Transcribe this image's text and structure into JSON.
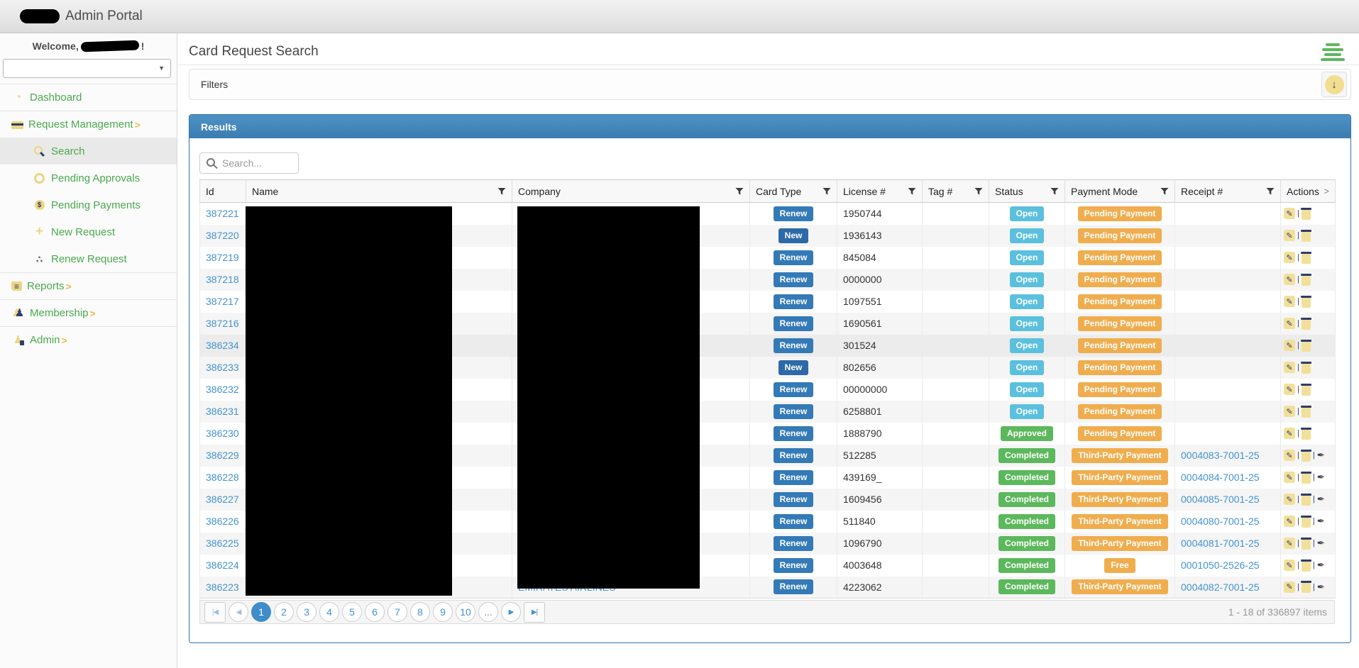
{
  "header": {
    "app_title": "Admin Portal"
  },
  "sidebar": {
    "welcome_prefix": "Welcome,",
    "welcome_suffix": "!",
    "nav": [
      {
        "label": "Dashboard",
        "icon": "dashboard-icon",
        "level": 1,
        "expandable": false,
        "active": false
      },
      {
        "label": "Request Management",
        "icon": "card-icon",
        "level": 1,
        "expandable": true,
        "active": false
      },
      {
        "label": "Search",
        "icon": "search-icon",
        "level": 2,
        "expandable": false,
        "active": true
      },
      {
        "label": "Pending Approvals",
        "icon": "pending-approvals-icon",
        "level": 2,
        "expandable": false,
        "active": false
      },
      {
        "label": "Pending Payments",
        "icon": "money-bag-icon",
        "level": 2,
        "expandable": false,
        "active": false
      },
      {
        "label": "New Request",
        "icon": "plus-icon",
        "level": 2,
        "expandable": false,
        "active": false
      },
      {
        "label": "Renew Request",
        "icon": "renew-icon",
        "level": 2,
        "expandable": false,
        "active": false
      },
      {
        "label": "Reports",
        "icon": "reports-icon",
        "level": 1,
        "expandable": true,
        "active": false
      },
      {
        "label": "Membership",
        "icon": "membership-icon",
        "level": 1,
        "expandable": true,
        "active": false
      },
      {
        "label": "Admin",
        "icon": "admin-icon",
        "level": 1,
        "expandable": true,
        "active": false
      }
    ]
  },
  "page": {
    "title": "Card Request Search"
  },
  "filters": {
    "label": "Filters"
  },
  "results": {
    "title": "Results",
    "search_placeholder": "Search...",
    "columns": [
      {
        "label": "Id",
        "filter": false
      },
      {
        "label": "Name",
        "filter": true
      },
      {
        "label": "Company",
        "filter": true
      },
      {
        "label": "Card Type",
        "filter": true
      },
      {
        "label": "License #",
        "filter": true
      },
      {
        "label": "Tag #",
        "filter": true
      },
      {
        "label": "Status",
        "filter": true
      },
      {
        "label": "Payment Mode",
        "filter": true
      },
      {
        "label": "Receipt #",
        "filter": true
      },
      {
        "label": "Actions",
        "filter": false,
        "chevron": ">"
      }
    ],
    "rows": [
      {
        "id": "387221",
        "company": "",
        "card_type": "Renew",
        "license": "1950744",
        "tag": "",
        "status": "Open",
        "payment_mode": "Pending Payment",
        "receipt": "",
        "actions": [
          "edit",
          "delete"
        ],
        "highlighted": false
      },
      {
        "id": "387220",
        "company": "",
        "card_type": "New",
        "license": "1936143",
        "tag": "",
        "status": "Open",
        "payment_mode": "Pending Payment",
        "receipt": "",
        "actions": [
          "edit",
          "delete"
        ],
        "highlighted": false
      },
      {
        "id": "387219",
        "company": "",
        "card_type": "Renew",
        "license": "845084",
        "tag": "",
        "status": "Open",
        "payment_mode": "Pending Payment",
        "receipt": "",
        "actions": [
          "edit",
          "delete"
        ],
        "highlighted": false
      },
      {
        "id": "387218",
        "company": "",
        "card_type": "Renew",
        "license": "0000000",
        "tag": "",
        "status": "Open",
        "payment_mode": "Pending Payment",
        "receipt": "",
        "actions": [
          "edit",
          "delete"
        ],
        "highlighted": false
      },
      {
        "id": "387217",
        "company": "",
        "card_type": "Renew",
        "license": "1097551",
        "tag": "",
        "status": "Open",
        "payment_mode": "Pending Payment",
        "receipt": "",
        "actions": [
          "edit",
          "delete"
        ],
        "highlighted": false
      },
      {
        "id": "387216",
        "company": "",
        "card_type": "Renew",
        "license": "1690561",
        "tag": "",
        "status": "Open",
        "payment_mode": "Pending Payment",
        "receipt": "",
        "actions": [
          "edit",
          "delete"
        ],
        "highlighted": false
      },
      {
        "id": "386234",
        "company": "",
        "card_type": "Renew",
        "license": "301524",
        "tag": "",
        "status": "Open",
        "payment_mode": "Pending Payment",
        "receipt": "",
        "actions": [
          "edit",
          "delete"
        ],
        "highlighted": true
      },
      {
        "id": "386233",
        "company": "",
        "card_type": "New",
        "license": "802656",
        "tag": "",
        "status": "Open",
        "payment_mode": "Pending Payment",
        "receipt": "",
        "actions": [
          "edit",
          "delete"
        ],
        "highlighted": false
      },
      {
        "id": "386232",
        "company": "",
        "card_type": "Renew",
        "license": "00000000",
        "tag": "",
        "status": "Open",
        "payment_mode": "Pending Payment",
        "receipt": "",
        "actions": [
          "edit",
          "delete"
        ],
        "highlighted": false
      },
      {
        "id": "386231",
        "company": "",
        "card_type": "Renew",
        "license": "6258801",
        "tag": "",
        "status": "Open",
        "payment_mode": "Pending Payment",
        "receipt": "",
        "actions": [
          "edit",
          "delete"
        ],
        "highlighted": false
      },
      {
        "id": "386230",
        "company": "",
        "card_type": "Renew",
        "license": "1888790",
        "tag": "",
        "status": "Approved",
        "payment_mode": "Pending Payment",
        "receipt": "",
        "actions": [
          "edit",
          "delete"
        ],
        "highlighted": false
      },
      {
        "id": "386229",
        "company": "",
        "card_type": "Renew",
        "license": "512285",
        "tag": "",
        "status": "Completed",
        "payment_mode": "Third-Party Payment",
        "receipt": "0004083-7001-25",
        "actions": [
          "edit",
          "delete",
          "sign"
        ],
        "highlighted": false
      },
      {
        "id": "386228",
        "company": "",
        "card_type": "Renew",
        "license": "439169_",
        "tag": "",
        "status": "Completed",
        "payment_mode": "Third-Party Payment",
        "receipt": "0004084-7001-25",
        "actions": [
          "edit",
          "delete",
          "sign"
        ],
        "highlighted": false
      },
      {
        "id": "386227",
        "company": "",
        "card_type": "Renew",
        "license": "1609456",
        "tag": "",
        "status": "Completed",
        "payment_mode": "Third-Party Payment",
        "receipt": "0004085-7001-25",
        "actions": [
          "edit",
          "delete",
          "sign"
        ],
        "highlighted": false
      },
      {
        "id": "386226",
        "company": "",
        "card_type": "Renew",
        "license": "511840",
        "tag": "",
        "status": "Completed",
        "payment_mode": "Third-Party Payment",
        "receipt": "0004080-7001-25",
        "actions": [
          "edit",
          "delete",
          "sign"
        ],
        "highlighted": false
      },
      {
        "id": "386225",
        "company": "",
        "card_type": "Renew",
        "license": "1096790",
        "tag": "",
        "status": "Completed",
        "payment_mode": "Third-Party Payment",
        "receipt": "0004081-7001-25",
        "actions": [
          "edit",
          "delete",
          "sign"
        ],
        "highlighted": false
      },
      {
        "id": "386224",
        "company": "",
        "card_type": "Renew",
        "license": "4003648",
        "tag": "",
        "status": "Completed",
        "payment_mode": "Free",
        "receipt": "0001050-2526-25",
        "actions": [
          "edit",
          "delete",
          "sign"
        ],
        "highlighted": false
      },
      {
        "id": "386223",
        "company": "EMIRATES AIRLINES",
        "card_type": "Renew",
        "license": "4223062",
        "tag": "",
        "status": "Completed",
        "payment_mode": "Third-Party Payment",
        "receipt": "0004082-7001-25",
        "actions": [
          "edit",
          "delete",
          "sign"
        ],
        "highlighted": false
      }
    ],
    "pagination": {
      "pages": [
        "1",
        "2",
        "3",
        "4",
        "5",
        "6",
        "7",
        "8",
        "9",
        "10",
        "..."
      ],
      "active_page": "1",
      "summary": "1 - 18 of 336897 items"
    }
  },
  "colors": {
    "card_type_renew": "#337ab7",
    "card_type_new": "#2c69a8",
    "status_open": "#5bc0de",
    "status_green": "#5cb85c",
    "payment_orange": "#f0ad4e",
    "link_blue": "#4393d0",
    "sidebar_green": "#4aa94e",
    "panel_header_blue": "#4189bd"
  }
}
